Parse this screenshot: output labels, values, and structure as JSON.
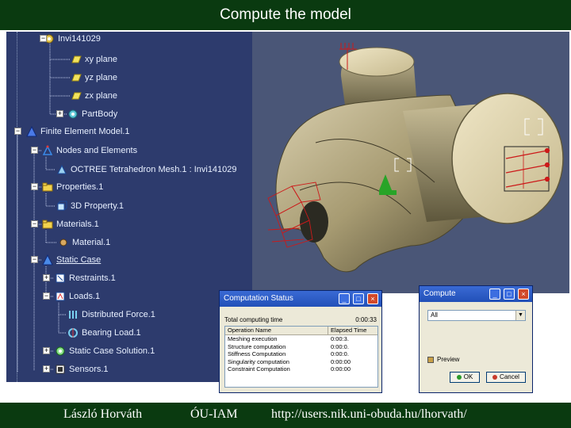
{
  "slide": {
    "title": "Compute the model"
  },
  "tree": {
    "items": [
      {
        "label": "Invi141029",
        "underline": false
      },
      {
        "label": "xy plane"
      },
      {
        "label": "yz plane"
      },
      {
        "label": "zx plane"
      },
      {
        "label": "PartBody"
      },
      {
        "label": "Finite Element Model.1"
      },
      {
        "label": "Nodes and Elements"
      },
      {
        "label": "OCTREE Tetrahedron Mesh.1 : Invi141029"
      },
      {
        "label": "Properties.1"
      },
      {
        "label": "3D Property.1"
      },
      {
        "label": "Materials.1"
      },
      {
        "label": "Material.1"
      },
      {
        "label": "Static Case"
      },
      {
        "label": "Restraints.1"
      },
      {
        "label": "Loads.1"
      },
      {
        "label": "Distributed Force.1"
      },
      {
        "label": "Bearing Load.1"
      },
      {
        "label": "Static Case Solution.1"
      },
      {
        "label": "Sensors.1"
      }
    ]
  },
  "computation_status": {
    "title": "Computation Status",
    "total_label": "Total computing time",
    "total_value": "0:00:33",
    "col_operation": "Operation Name",
    "col_elapsed": "Elapsed Time",
    "rows": [
      {
        "name": "Meshing execution",
        "time": "0:00:3."
      },
      {
        "name": "Structure computation",
        "time": "0:00:0."
      },
      {
        "name": "Stiffness Computation",
        "time": "0:00:0."
      },
      {
        "name": "Singularity computation",
        "time": "0:00:00"
      },
      {
        "name": "Constraint Computation",
        "time": "0:00:00"
      }
    ]
  },
  "compute_dialog": {
    "title": "Compute",
    "select_value": "All",
    "preview_label": "Preview",
    "preview_checked": false,
    "ok_label": "OK",
    "cancel_label": "Cancel"
  },
  "footer": {
    "author": "László Horváth",
    "institution": "ÓU-IAM",
    "url": "http://users.nik.uni-obuda.hu/lhorvath/"
  },
  "colors": {
    "header_bg": "#0a3a10",
    "tree_bg": "#2d3b6d",
    "dialog_title": "#2250b8"
  }
}
